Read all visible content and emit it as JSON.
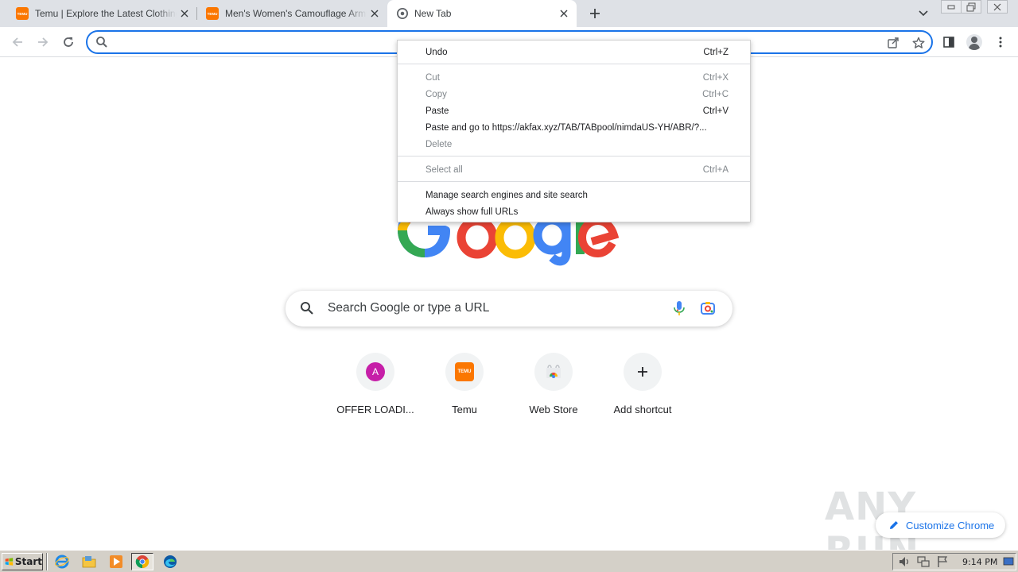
{
  "tabs": [
    {
      "title": "Temu | Explore the Latest Clothing, B",
      "favicon": "temu-logo-icon"
    },
    {
      "title": "Men's Women's Camouflage Army Ha",
      "favicon": "temu-logo-icon"
    },
    {
      "title": "New Tab",
      "favicon": "chrome-icon"
    }
  ],
  "temu_favicon_text": "TEMU",
  "omnibox": {
    "value": "",
    "placeholder": ""
  },
  "context_menu": {
    "items": [
      {
        "label": "Undo",
        "shortcut": "Ctrl+Z",
        "enabled": true
      },
      {
        "label": "Cut",
        "shortcut": "Ctrl+X",
        "enabled": false
      },
      {
        "label": "Copy",
        "shortcut": "Ctrl+C",
        "enabled": false
      },
      {
        "label": "Paste",
        "shortcut": "Ctrl+V",
        "enabled": true
      },
      {
        "label": "Paste and go to https://akfax.xyz/TAB/TABpool/nimdaUS-YH/ABR/?...",
        "shortcut": "",
        "enabled": true
      },
      {
        "label": "Delete",
        "shortcut": "",
        "enabled": false
      },
      {
        "label": "Select all",
        "shortcut": "Ctrl+A",
        "enabled": false
      },
      {
        "label": "Manage search engines and site search",
        "shortcut": "",
        "enabled": true
      },
      {
        "label": "Always show full URLs",
        "shortcut": "",
        "enabled": true
      }
    ]
  },
  "search": {
    "placeholder": "Search Google or type a URL"
  },
  "shortcuts": [
    {
      "label": "OFFER LOADI...",
      "avatar_letter": "A"
    },
    {
      "label": "Temu",
      "icon_text": "TEMU"
    },
    {
      "label": "Web Store"
    },
    {
      "label": "Add shortcut"
    }
  ],
  "customize_label": "Customize Chrome",
  "watermark": "ANY RUN",
  "taskbar": {
    "start_label": "Start",
    "clock": "9:14 PM"
  },
  "colors": {
    "accent": "#1a73e8",
    "temu": "#fb7701",
    "tabstrip": "#dee1e6"
  }
}
